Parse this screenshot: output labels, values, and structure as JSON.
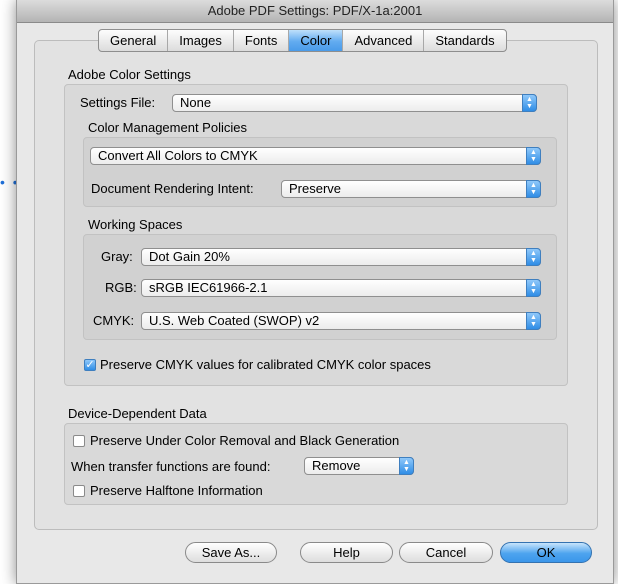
{
  "window": {
    "title": "Adobe PDF Settings: PDF/X-1a:2001"
  },
  "tabs": [
    "General",
    "Images",
    "Fonts",
    "Color",
    "Advanced",
    "Standards"
  ],
  "active_tab": "Color",
  "adobe_color_settings": {
    "heading": "Adobe Color Settings",
    "settings_file_label": "Settings File:",
    "settings_file_value": "None",
    "policies_heading": "Color Management Policies",
    "policy_value": "Convert All Colors to CMYK",
    "rendering_intent_label": "Document Rendering Intent:",
    "rendering_intent_value": "Preserve"
  },
  "working_spaces": {
    "heading": "Working Spaces",
    "gray_label": "Gray:",
    "gray_value": "Dot Gain 20%",
    "rgb_label": "RGB:",
    "rgb_value": "sRGB IEC61966-2.1",
    "cmyk_label": "CMYK:",
    "cmyk_value": "U.S. Web Coated (SWOP) v2"
  },
  "preserve_cmyk": {
    "label": "Preserve CMYK values for calibrated CMYK color spaces",
    "checked": true
  },
  "device_dependent": {
    "heading": "Device-Dependent Data",
    "preserve_ucr_label": "Preserve Under Color Removal and Black Generation",
    "preserve_ucr_checked": false,
    "transfer_label": "When transfer functions are found:",
    "transfer_value": "Remove",
    "halftone_label": "Preserve Halftone Information",
    "halftone_checked": false
  },
  "buttons": {
    "save_as": "Save As...",
    "help": "Help",
    "cancel": "Cancel",
    "ok": "OK"
  },
  "icons": {
    "popup_arrows": "up-down-arrows-icon",
    "checkmark": "checkmark-icon"
  },
  "colors": {
    "accent": "#4a9be9",
    "window_bg": "#e8e8e8"
  }
}
